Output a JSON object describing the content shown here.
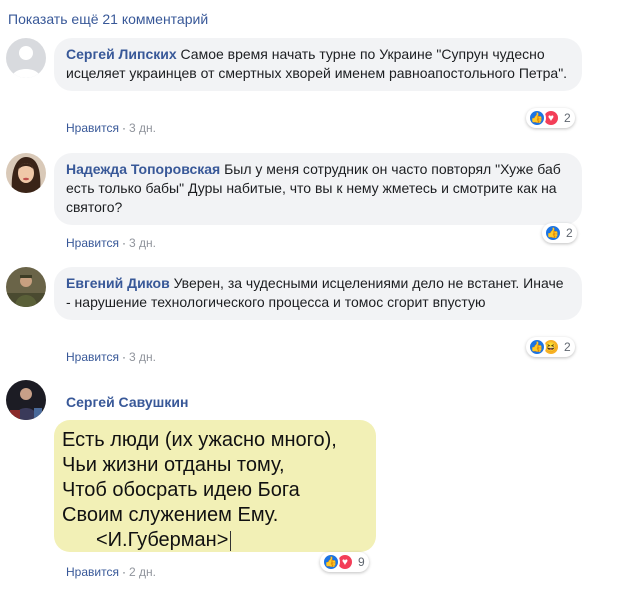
{
  "show_more": "Показать ещё 21 комментарий",
  "comments": [
    {
      "author": "Сергей Липских",
      "text": "Самое время начать турне по Украине \"Супрун чудесно исцеляет украинцев от смертных хворей именем равноапостольного Петра\".",
      "like": "Нравится",
      "time": "3 дн.",
      "reaction_count": "2"
    },
    {
      "author": "Надежда Топоровская",
      "text": "Был у меня сотрудник он часто повторял \"Хуже баб есть только бабы\" Дуры набитые, что вы к нему жметесь и смотрите как на святого?",
      "like": "Нравится",
      "time": "3 дн.",
      "reaction_count": "2"
    },
    {
      "author": "Евгений Диков",
      "text": "Уверен, за чудесными исцелениями дело не встанет. Иначе - нарушение технологического процесса и томос сгорит впустую",
      "like": "Нравится",
      "time": "3 дн.",
      "reaction_count": "2"
    },
    {
      "author": "Сергей Савушкин",
      "image_lines": [
        "Есть люди (их ужасно много),",
        "Чьи жизни отданы тому,",
        "Чтоб обосрать идею Бога",
        "Своим служением Ему.",
        "<И.Губерман>"
      ],
      "like": "Нравится",
      "time": "2 дн.",
      "reaction_count": "9"
    }
  ],
  "colors": {
    "link": "#385898",
    "bubble": "#f2f3f5",
    "image_bg": "#f2f0b6",
    "like": "#1b74e4",
    "love": "#f33e58",
    "haha": "#f7b125"
  }
}
